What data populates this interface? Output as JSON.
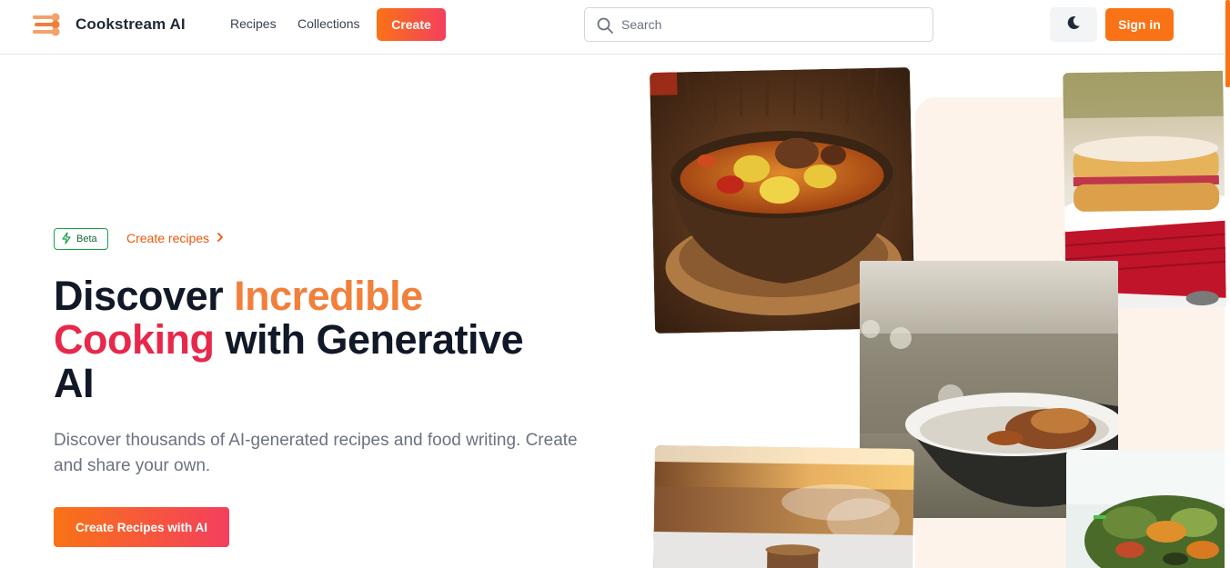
{
  "header": {
    "brand": "Cookstream AI",
    "logo_icon": "utensils-logo-icon",
    "nav": [
      {
        "label": "Recipes"
      },
      {
        "label": "Collections"
      }
    ],
    "create_label": "Create",
    "search": {
      "placeholder": "Search",
      "icon": "search-icon"
    },
    "theme_icon": "moon-icon",
    "signin_label": "Sign in"
  },
  "hero": {
    "badge_label": "Beta",
    "badge_icon": "lightning-icon",
    "link_label": "Create recipes",
    "headline": {
      "part1": "Discover ",
      "part2": "Incredible",
      "part3": "Cooking",
      "part4": " with Generative AI"
    },
    "subtitle": "Discover thousands of AI-generated recipes and food writing. Create and share your own.",
    "cta_label": "Create Recipes with AI"
  },
  "colors": {
    "accent_orange": "#f97316",
    "accent_pink": "#f43f5e",
    "headline_orange": "#f0803c",
    "headline_pink": "#e6294b",
    "panel_peach": "#fdf3ea",
    "badge_green": "#16a34a"
  },
  "collage": [
    {
      "name": "curry-stew-photo"
    },
    {
      "name": "victoria-sponge-cake-photo"
    },
    {
      "name": "salmon-bowl-photo"
    },
    {
      "name": "steaming-soup-photo"
    },
    {
      "name": "salad-photo"
    }
  ]
}
